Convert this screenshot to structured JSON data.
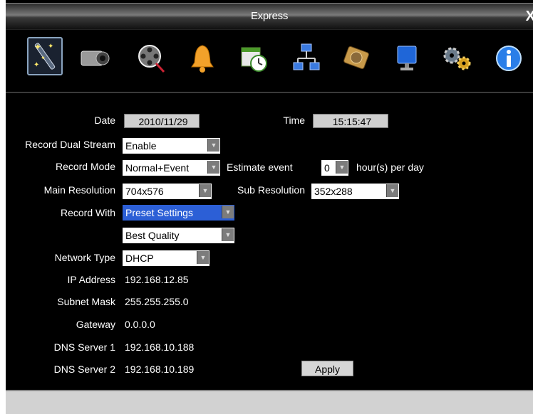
{
  "window": {
    "title": "Express",
    "close_glyph": "X"
  },
  "toolbar": {
    "icons": [
      "wand-icon",
      "camera-icon",
      "film-reel-icon",
      "bell-icon",
      "schedule-icon",
      "network-icon",
      "hdd-icon",
      "monitor-icon",
      "gears-icon",
      "info-icon"
    ],
    "selected": "wand-icon"
  },
  "form": {
    "date_label": "Date",
    "date_value": "2010/11/29",
    "time_label": "Time",
    "time_value": "15:15:47",
    "dual_stream_label": "Record Dual Stream",
    "dual_stream_value": "Enable",
    "record_mode_label": "Record Mode",
    "record_mode_value": "Normal+Event",
    "estimate_label": "Estimate event",
    "estimate_value": "0",
    "estimate_unit": "hour(s) per day",
    "main_res_label": "Main Resolution",
    "main_res_value": "704x576",
    "sub_res_label": "Sub Resolution",
    "sub_res_value": "352x288",
    "record_with_label": "Record With",
    "record_with_value": "Preset Settings",
    "quality_value": "Best Quality",
    "network_type_label": "Network Type",
    "network_type_value": "DHCP",
    "ip_label": "IP Address",
    "ip_value": "192.168.12.85",
    "subnet_label": "Subnet Mask",
    "subnet_value": "255.255.255.0",
    "gateway_label": "Gateway",
    "gateway_value": "0.0.0.0",
    "dns1_label": "DNS Server 1",
    "dns1_value": "192.168.10.188",
    "dns2_label": "DNS Server 2",
    "dns2_value": "192.168.10.189",
    "apply_label": "Apply"
  },
  "colors": {
    "background": "#000000",
    "highlight": "#2c5fd6",
    "field_bg": "#cfcfcf"
  }
}
